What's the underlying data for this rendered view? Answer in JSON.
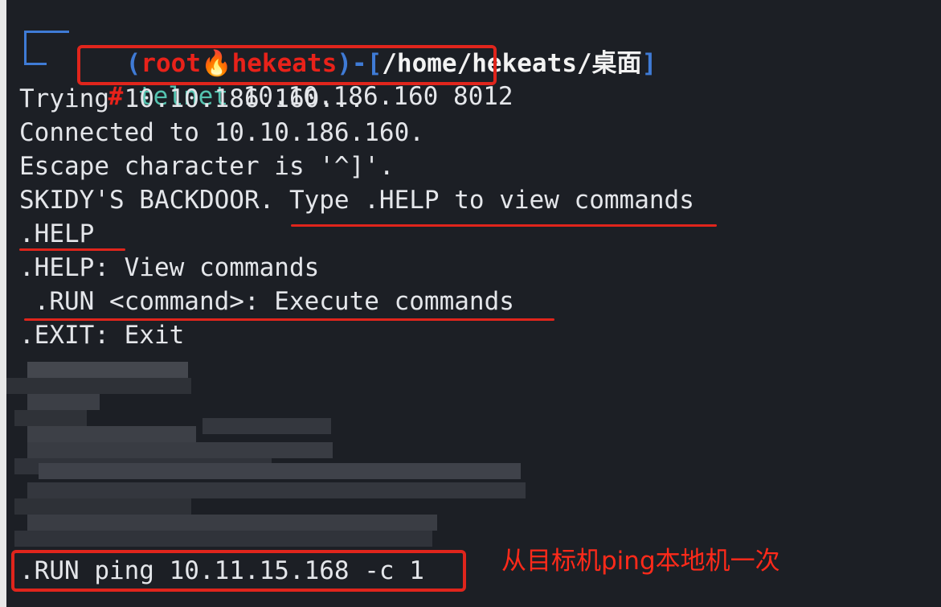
{
  "prompt": {
    "open_paren": "(",
    "user": "root",
    "fire_icon": "🔥",
    "host": "hekeats",
    "close_paren": ")",
    "dash": "-",
    "path_open": "[",
    "path": "/home/hekeats/桌面",
    "path_close": "]",
    "hash": "#"
  },
  "command": {
    "name": "telnet",
    "args": " 10.10.186.160 8012"
  },
  "output": [
    "Trying 10.10.186.160...",
    "Connected to 10.10.186.160.",
    "Escape character is '^]'.",
    "SKIDY'S BACKDOOR. Type .HELP to view commands",
    ".HELP",
    ".HELP: View commands",
    " .RUN <command>: Execute commands",
    ".EXIT: Exit"
  ],
  "run_command": ".RUN ping 10.11.15.168 -c 1",
  "annotation": "从目标机ping本地机一次",
  "colors": {
    "background": "#1c1f25",
    "text": "#e4e6ea",
    "prompt_blue": "#3f7bd6",
    "prompt_red": "#e8221a",
    "command_teal": "#55c3b0",
    "highlight_red": "#e0251c"
  }
}
